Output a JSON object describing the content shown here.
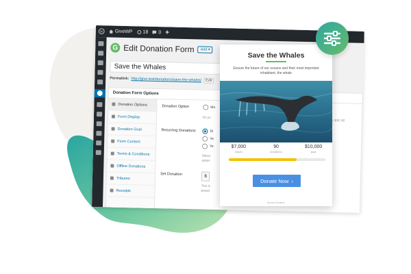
{
  "admin_bar": {
    "site_name": "GiveWP",
    "updates_count": "18",
    "comments_count": "0",
    "new_label": "+"
  },
  "header": {
    "logo_letter": "G",
    "title": "Edit Donation Form",
    "add_button": "Add"
  },
  "form": {
    "title_value": "Save the Whales",
    "permalink_label": "Permalink:",
    "permalink_url": "http://give.test/donations/save-the-whales/",
    "edit_label": "Edit"
  },
  "options_panel": {
    "title": "Donation Form Options",
    "tabs": [
      {
        "label": "Donation Options",
        "active": true
      },
      {
        "label": "Form Display"
      },
      {
        "label": "Donation Goal"
      },
      {
        "label": "Form Content"
      },
      {
        "label": "Terms & Conditions"
      },
      {
        "label": "Offline Donations"
      },
      {
        "label": "Tributes"
      },
      {
        "label": "Receipts"
      }
    ],
    "fields": {
      "donation_option": {
        "label": "Donation Option",
        "option_1": "Mu",
        "hint": "Do yo"
      },
      "recurring": {
        "label": "Recurring Donations",
        "option_1": "Di",
        "option_2": "Ye",
        "option_3": "Ye",
        "hint_1": "Select",
        "hint_2": "option"
      },
      "set_donation": {
        "label": "Set Donation",
        "currency": "$",
        "hint_1": "This is",
        "hint_2": "preset"
      },
      "right_hint": "ple, $10, $2"
    }
  },
  "card": {
    "title": "Save the Whales",
    "description": "Ensure the future of our oceans and their most important inhabitant, the whale",
    "stats": [
      {
        "value": "$7,000",
        "label": "raised"
      },
      {
        "value": "90",
        "label": "donations"
      },
      {
        "value": "$10,000",
        "label": "goal"
      }
    ],
    "progress_percent": 70,
    "donate_label": "Donate Now",
    "donate_arrow": "›",
    "secure_label": "Secure Donation"
  },
  "colors": {
    "accent_green": "#66bb6a",
    "teal": "#2fa7a0",
    "wp_dark": "#23282d",
    "wp_blue": "#0073aa",
    "button_blue": "#4a90e2",
    "progress_yellow": "#f2c205"
  },
  "icons": [
    "wordpress-icon",
    "home-icon",
    "updates-icon",
    "comments-icon",
    "plus-icon",
    "settings-sliders-icon",
    "give-logo-icon"
  ]
}
